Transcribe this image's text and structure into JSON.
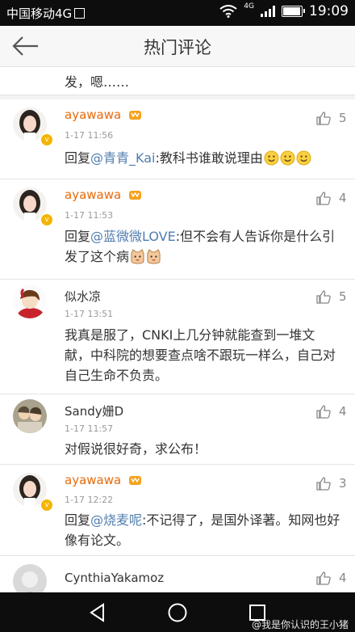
{
  "status_bar": {
    "carrier": "中国移动4G",
    "network": "4G",
    "time": "19:09"
  },
  "header": {
    "title": "热门评论"
  },
  "partial_text": "发，嗯……",
  "comments": [
    {
      "username": "ayawawa",
      "time": "1-17 11:56",
      "likes": "5",
      "reply_prefix": "回复",
      "mention": "@青青_Kai",
      "text": ":教科书谁敢说理由",
      "emojis": [
        "smile-emoji",
        "smile-emoji",
        "smile-emoji"
      ]
    },
    {
      "username": "ayawawa",
      "time": "1-17 11:53",
      "likes": "4",
      "reply_prefix": "回复",
      "mention": "@蓝微微LOVE",
      "text": ":但不会有人告诉你是什么引发了这个病",
      "emojis": [
        "cat-emoji",
        "cat-emoji"
      ]
    },
    {
      "username": "似水凉",
      "time": "1-17 13:51",
      "likes": "5",
      "text": "我真是服了，CNKI上几分钟就能查到一堆文献，中科院的想要查点啥不跟玩一样么，自己对自己生命不负责。"
    },
    {
      "username": "Sandy姗D",
      "time": "1-17 11:57",
      "likes": "4",
      "text": "对假说很好奇，求公布！"
    },
    {
      "username": "ayawawa",
      "time": "1-17 12:22",
      "likes": "3",
      "reply_prefix": "回复",
      "mention": "@烧麦呢",
      "text": ":不记得了，是国外译著。知网也好像有论文。"
    },
    {
      "username": "CynthiaYakamoz",
      "likes": "4"
    }
  ],
  "watermark": "@我是你认识的王小猪",
  "colors": {
    "username_vip": "#e86a0b",
    "mention": "#507daf",
    "verified_badge": "#f5b400"
  }
}
